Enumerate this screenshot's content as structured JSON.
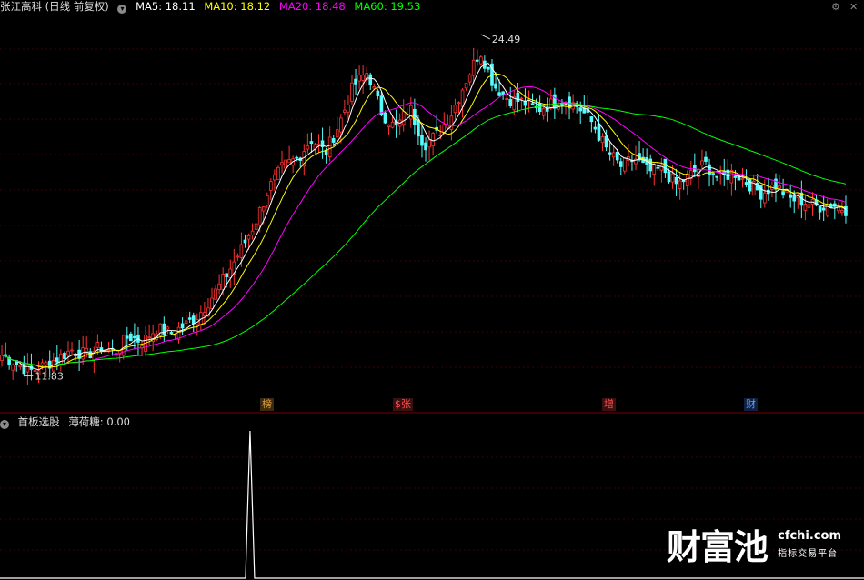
{
  "header": {
    "stock_title": "张江高科 (日线 前复权)",
    "ma_labels": [
      {
        "text": "MA5: 18.11",
        "color": "#ffffff"
      },
      {
        "text": "MA10: 18.12",
        "color": "#ffff00"
      },
      {
        "text": "MA20: 18.48",
        "color": "#ff00ff"
      },
      {
        "text": "MA60: 19.53",
        "color": "#00ff00"
      }
    ],
    "settings_icon": "settings-circle-icon",
    "window_icons": [
      "settings-gear-icon",
      "close-icon"
    ]
  },
  "sub_header": {
    "indicator_name": "首板选股",
    "indicator_value": "薄荷糖: 0.00"
  },
  "annotations": {
    "high_label": "24.49",
    "low_label": "11.83"
  },
  "markers": [
    {
      "text": "榜",
      "color": "#e0a040",
      "bg": "#3a2a10"
    },
    {
      "text": "$张",
      "color": "#ff5050",
      "bg": "#3a1010"
    },
    {
      "text": "增",
      "color": "#ff5050",
      "bg": "#3a1010"
    },
    {
      "text": "财",
      "color": "#60a0ff",
      "bg": "#102040"
    }
  ],
  "watermark": {
    "logo_text": "财富池",
    "url": "cfchi.com",
    "tagline": "指标交易平台"
  },
  "colors": {
    "up_candle": "#ff3232",
    "down_candle": "#54fcfc",
    "ma5": "#ffffff",
    "ma10": "#ffff00",
    "ma20": "#ff00ff",
    "ma60": "#00ff00",
    "grid": "#3a0000"
  },
  "chart_data": {
    "type": "candlestick",
    "price_range": [
      11.0,
      25.5
    ],
    "high": 24.49,
    "low": 11.83,
    "key_closes": [
      12.6,
      12.3,
      12.0,
      12.2,
      12.5,
      12.8,
      12.6,
      12.9,
      12.7,
      13.3,
      13.1,
      13.6,
      13.4,
      13.7,
      14.1,
      14.8,
      15.6,
      16.5,
      17.5,
      18.8,
      19.6,
      19.9,
      20.6,
      20.1,
      21.2,
      22.6,
      23.1,
      21.6,
      21.0,
      21.8,
      20.4,
      20.8,
      21.6,
      22.8,
      23.9,
      22.6,
      22.1,
      22.0,
      21.7,
      21.9,
      22.1,
      21.8,
      21.2,
      20.2,
      19.6,
      19.9,
      19.4,
      19.5,
      18.9,
      19.3,
      19.7,
      19.1,
      19.4,
      19.0,
      18.6,
      18.9,
      18.4,
      18.3,
      18.1,
      18.2,
      18.0
    ]
  },
  "indicator_data": {
    "type": "line",
    "name": "薄荷糖",
    "spike_position": 0.295,
    "spike_value": 1,
    "baseline": 0
  }
}
